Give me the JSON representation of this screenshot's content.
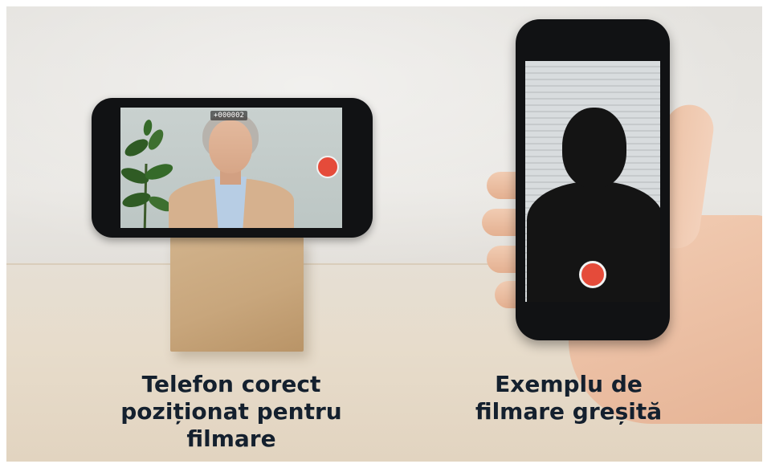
{
  "scene": {
    "left_phone": {
      "zoom_badge": "+000002"
    },
    "captions": {
      "left": "Telefon corect\npoziționat pentru\nfilmare",
      "right": "Exemplu de\nfilmare greșită"
    }
  },
  "colors": {
    "record_button": "#e54b3a",
    "caption_text": "#14202e",
    "phone_body": "#111214"
  },
  "icons": [
    "record-icon",
    "plant-icon"
  ]
}
